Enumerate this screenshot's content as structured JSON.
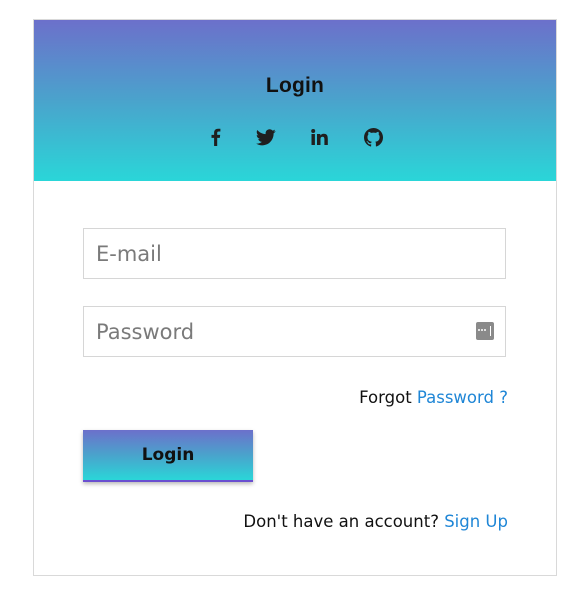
{
  "login_header": {
    "title": "Login",
    "social_icons": [
      "facebook-icon",
      "twitter-icon",
      "linkedin-icon",
      "github-icon"
    ],
    "gradient_colors": [
      "#6c70cb",
      "#2ad6d8"
    ]
  },
  "form": {
    "email_placeholder": "E-mail",
    "email_value": "",
    "password_placeholder": "Password",
    "password_value": "",
    "password_icon": "password-dots-icon",
    "forgot_prefix": "Forgot",
    "forgot_link": "Password ?",
    "submit_label": "Login",
    "signup_prefix": "Don't have an account?",
    "signup_link": "Sign Up",
    "link_color": "#1f86d6"
  }
}
